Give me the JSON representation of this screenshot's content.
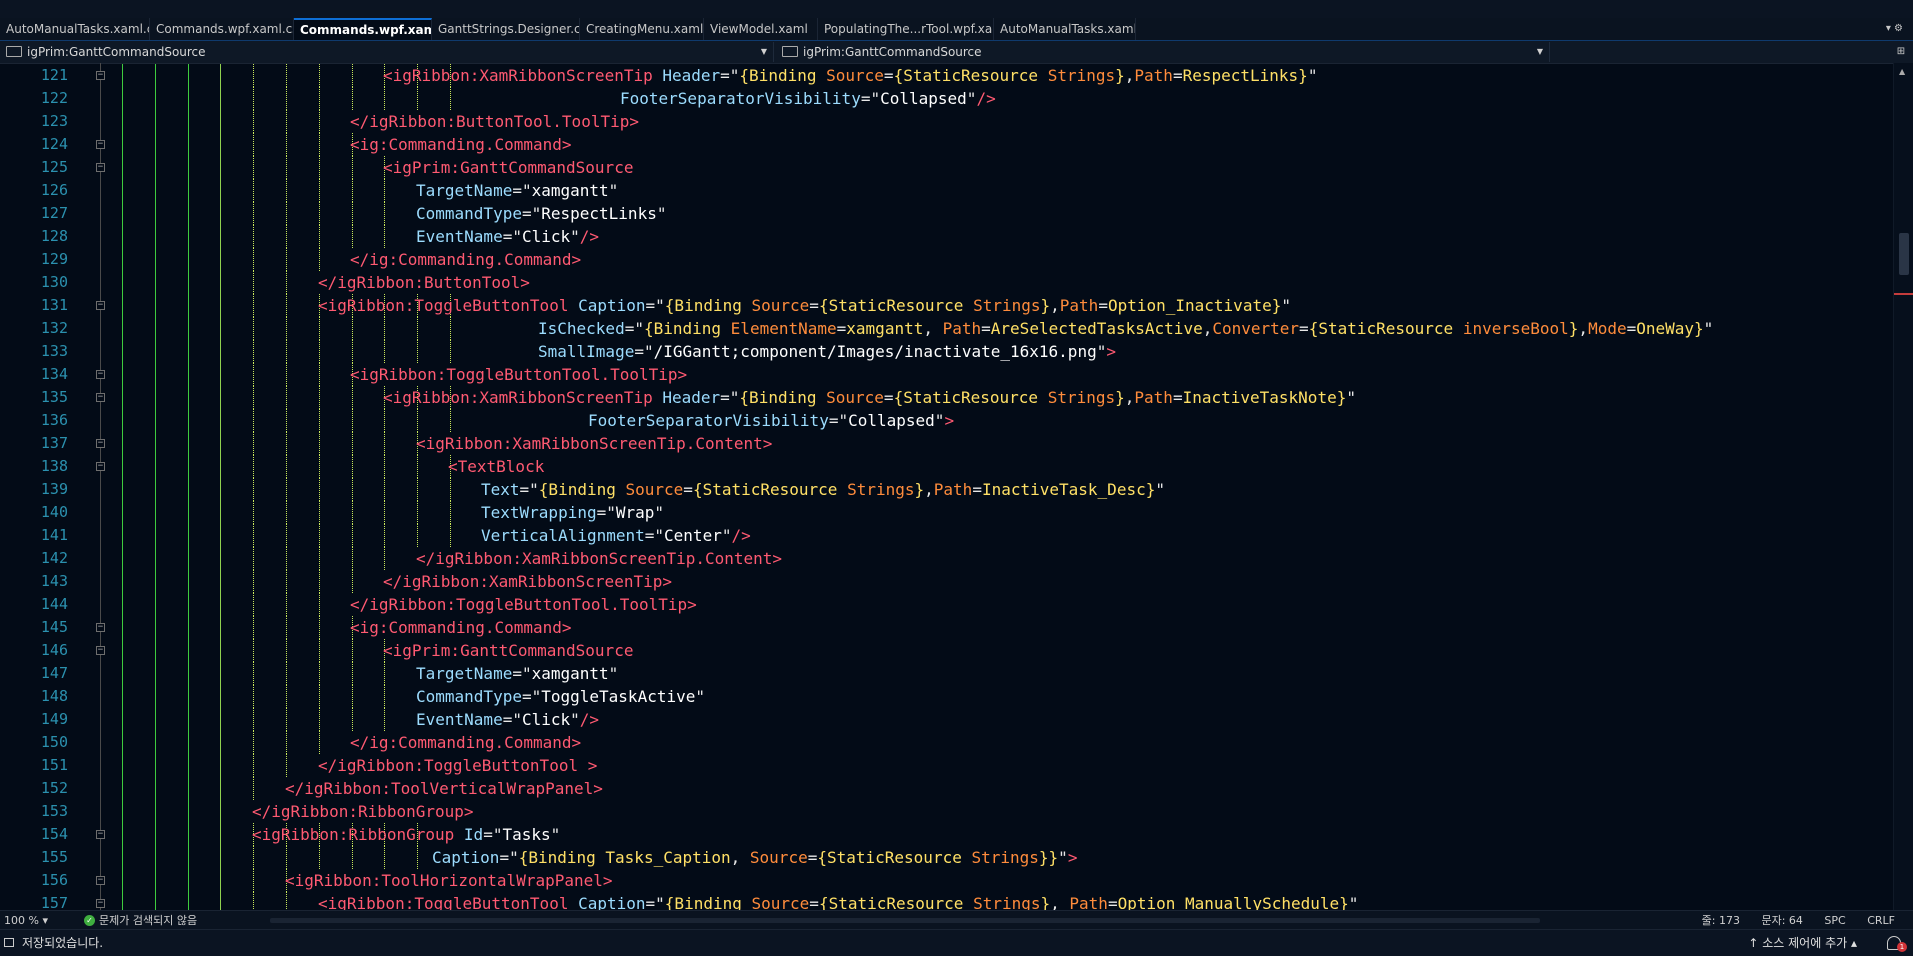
{
  "tabs": [
    {
      "label": "AutoManualTasks.xaml.cs",
      "pinned": true
    },
    {
      "label": "Commands.wpf.xaml.cs",
      "pinned": true
    },
    {
      "label": "Commands.wpf.xaml",
      "pinned": true,
      "active": true
    },
    {
      "label": "GanttStrings.Designer.cs"
    },
    {
      "label": "CreatingMenu.xaml"
    },
    {
      "label": "ViewModel.xaml"
    },
    {
      "label": "PopulatingThe...rTool.wpf.xaml"
    },
    {
      "label": "AutoManualTasks.xaml"
    }
  ],
  "tab_icons": {
    "pin": "📌",
    "close": "✕",
    "menu": "▾ ⚙"
  },
  "nav": {
    "left_selector": "igPrim:GanttCommandSource",
    "right_selector": "igPrim:GanttCommandSource"
  },
  "editor": {
    "line_numbers": [
      "121",
      "122",
      "123",
      "124",
      "125",
      "126",
      "127",
      "128",
      "129",
      "130",
      "131",
      "132",
      "133",
      "134",
      "135",
      "136",
      "137",
      "138",
      "139",
      "140",
      "141",
      "142",
      "143",
      "144",
      "145",
      "146",
      "147",
      "148",
      "149",
      "150",
      "151",
      "152",
      "153",
      "154",
      "155",
      "156",
      "157"
    ],
    "lines": [
      [
        [
          "b",
          "<"
        ],
        [
          "b",
          "igRibbon:XamRibbonScreenTip "
        ],
        [
          "a",
          "Header"
        ],
        [
          "p",
          "=\""
        ],
        [
          "y",
          "{Binding "
        ],
        [
          "k",
          "Source"
        ],
        [
          "p",
          "="
        ],
        [
          "y",
          "{StaticResource "
        ],
        [
          "k",
          "Strings"
        ],
        [
          "y",
          "}"
        ],
        [
          "p",
          ","
        ],
        [
          "k",
          "Path"
        ],
        [
          "p",
          "="
        ],
        [
          "y",
          "RespectLinks"
        ],
        [
          "y",
          "}"
        ],
        [
          "p",
          "\""
        ]
      ],
      [
        [
          "a",
          "FooterSeparatorVisibility"
        ],
        [
          "p",
          "=\""
        ],
        [
          "v",
          "Collapsed"
        ],
        [
          "p",
          "\""
        ],
        [
          "b",
          "/>"
        ]
      ],
      [
        [
          "b",
          "</igRibbon:ButtonTool.ToolTip>"
        ]
      ],
      [
        [
          "b",
          "<ig:Commanding.Command>"
        ]
      ],
      [
        [
          "b",
          "<igPrim:GanttCommandSource"
        ]
      ],
      [
        [
          "a",
          "TargetName"
        ],
        [
          "p",
          "=\""
        ],
        [
          "v",
          "xamgantt"
        ],
        [
          "p",
          "\""
        ]
      ],
      [
        [
          "a",
          "CommandType"
        ],
        [
          "p",
          "=\""
        ],
        [
          "v",
          "RespectLinks"
        ],
        [
          "p",
          "\""
        ]
      ],
      [
        [
          "a",
          "EventName"
        ],
        [
          "p",
          "=\""
        ],
        [
          "v",
          "Click"
        ],
        [
          "p",
          "\""
        ],
        [
          "b",
          "/>"
        ]
      ],
      [
        [
          "b",
          "</ig:Commanding.Command>"
        ]
      ],
      [
        [
          "b",
          "</igRibbon:ButtonTool>"
        ]
      ],
      [
        [
          "b",
          "<igRibbon:ToggleButtonTool "
        ],
        [
          "a",
          "Caption"
        ],
        [
          "p",
          "=\""
        ],
        [
          "y",
          "{Binding "
        ],
        [
          "k",
          "Source"
        ],
        [
          "p",
          "="
        ],
        [
          "y",
          "{StaticResource "
        ],
        [
          "k",
          "Strings"
        ],
        [
          "y",
          "}"
        ],
        [
          "p",
          ","
        ],
        [
          "k",
          "Path"
        ],
        [
          "p",
          "="
        ],
        [
          "y",
          "Option_Inactivate"
        ],
        [
          "y",
          "}"
        ],
        [
          "p",
          "\""
        ]
      ],
      [
        [
          "a",
          "IsChecked"
        ],
        [
          "p",
          "=\""
        ],
        [
          "y",
          "{Binding "
        ],
        [
          "k",
          "ElementName"
        ],
        [
          "p",
          "="
        ],
        [
          "y",
          "xamgantt"
        ],
        [
          "p",
          ", "
        ],
        [
          "k",
          "Path"
        ],
        [
          "p",
          "="
        ],
        [
          "y",
          "AreSelectedTasksActive"
        ],
        [
          "p",
          ","
        ],
        [
          "k",
          "Converter"
        ],
        [
          "p",
          "="
        ],
        [
          "y",
          "{StaticResource "
        ],
        [
          "k",
          "inverseBool"
        ],
        [
          "y",
          "}"
        ],
        [
          "p",
          ","
        ],
        [
          "k",
          "Mode"
        ],
        [
          "p",
          "="
        ],
        [
          "y",
          "OneWay"
        ],
        [
          "y",
          "}"
        ],
        [
          "p",
          "\""
        ]
      ],
      [
        [
          "a",
          "SmallImage"
        ],
        [
          "p",
          "=\""
        ],
        [
          "v",
          "/IGGantt;component/Images/inactivate_16x16.png"
        ],
        [
          "p",
          "\""
        ],
        [
          "b",
          ">"
        ]
      ],
      [
        [
          "b",
          "<igRibbon:ToggleButtonTool.ToolTip>"
        ]
      ],
      [
        [
          "b",
          "<igRibbon:XamRibbonScreenTip "
        ],
        [
          "a",
          "Header"
        ],
        [
          "p",
          "=\""
        ],
        [
          "y",
          "{Binding "
        ],
        [
          "k",
          "Source"
        ],
        [
          "p",
          "="
        ],
        [
          "y",
          "{StaticResource "
        ],
        [
          "k",
          "Strings"
        ],
        [
          "y",
          "}"
        ],
        [
          "p",
          ","
        ],
        [
          "k",
          "Path"
        ],
        [
          "p",
          "="
        ],
        [
          "y",
          "InactiveTaskNote"
        ],
        [
          "y",
          "}"
        ],
        [
          "p",
          "\""
        ]
      ],
      [
        [
          "a",
          "FooterSeparatorVisibility"
        ],
        [
          "p",
          "=\""
        ],
        [
          "v",
          "Collapsed"
        ],
        [
          "p",
          "\""
        ],
        [
          "b",
          ">"
        ]
      ],
      [
        [
          "b",
          "<igRibbon:XamRibbonScreenTip.Content>"
        ]
      ],
      [
        [
          "b",
          "<TextBlock"
        ]
      ],
      [
        [
          "a",
          "Text"
        ],
        [
          "p",
          "=\""
        ],
        [
          "y",
          "{Binding "
        ],
        [
          "k",
          "Source"
        ],
        [
          "p",
          "="
        ],
        [
          "y",
          "{StaticResource "
        ],
        [
          "k",
          "Strings"
        ],
        [
          "y",
          "}"
        ],
        [
          "p",
          ","
        ],
        [
          "k",
          "Path"
        ],
        [
          "p",
          "="
        ],
        [
          "y",
          "InactiveTask_Desc"
        ],
        [
          "y",
          "}"
        ],
        [
          "p",
          "\""
        ]
      ],
      [
        [
          "a",
          "TextWrapping"
        ],
        [
          "p",
          "=\""
        ],
        [
          "v",
          "Wrap"
        ],
        [
          "p",
          "\""
        ]
      ],
      [
        [
          "a",
          "VerticalAlignment"
        ],
        [
          "p",
          "=\""
        ],
        [
          "v",
          "Center"
        ],
        [
          "p",
          "\""
        ],
        [
          "b",
          "/>"
        ]
      ],
      [
        [
          "b",
          "</igRibbon:XamRibbonScreenTip.Content>"
        ]
      ],
      [
        [
          "b",
          "</igRibbon:XamRibbonScreenTip>"
        ]
      ],
      [
        [
          "b",
          "</igRibbon:ToggleButtonTool.ToolTip>"
        ]
      ],
      [
        [
          "b",
          "<ig:Commanding.Command>"
        ]
      ],
      [
        [
          "b",
          "<igPrim:GanttCommandSource"
        ]
      ],
      [
        [
          "a",
          "TargetName"
        ],
        [
          "p",
          "=\""
        ],
        [
          "v",
          "xamgantt"
        ],
        [
          "p",
          "\""
        ]
      ],
      [
        [
          "a",
          "CommandType"
        ],
        [
          "p",
          "=\""
        ],
        [
          "v",
          "ToggleTaskActive"
        ],
        [
          "p",
          "\""
        ]
      ],
      [
        [
          "a",
          "EventName"
        ],
        [
          "p",
          "=\""
        ],
        [
          "v",
          "Click"
        ],
        [
          "p",
          "\""
        ],
        [
          "b",
          "/>"
        ]
      ],
      [
        [
          "b",
          "</ig:Commanding.Command>"
        ]
      ],
      [
        [
          "b",
          "</igRibbon:ToggleButtonTool "
        ],
        [
          "b",
          ">"
        ]
      ],
      [
        [
          "b",
          "</igRibbon:ToolVerticalWrapPanel>"
        ]
      ],
      [
        [
          "b",
          "</igRibbon:RibbonGroup>"
        ]
      ],
      [
        [
          "b",
          "<igRibbon:RibbonGroup "
        ],
        [
          "a",
          "Id"
        ],
        [
          "p",
          "=\""
        ],
        [
          "v",
          "Tasks"
        ],
        [
          "p",
          "\""
        ]
      ],
      [
        [
          "a",
          "Caption"
        ],
        [
          "p",
          "=\""
        ],
        [
          "y",
          "{Binding "
        ],
        [
          "y",
          "Tasks_Caption"
        ],
        [
          "p",
          ", "
        ],
        [
          "k",
          "Source"
        ],
        [
          "p",
          "="
        ],
        [
          "y",
          "{StaticResource "
        ],
        [
          "k",
          "Strings"
        ],
        [
          "y",
          "}}"
        ],
        [
          "p",
          "\""
        ],
        [
          "b",
          ">"
        ]
      ],
      [
        [
          "b",
          "<igRibbon:ToolHorizontalWrapPanel>"
        ]
      ],
      [
        [
          "b",
          "<igRibbon:ToggleButtonTool "
        ],
        [
          "a",
          "Caption"
        ],
        [
          "p",
          "=\""
        ],
        [
          "y",
          "{Binding "
        ],
        [
          "k",
          "Source"
        ],
        [
          "p",
          "="
        ],
        [
          "y",
          "{StaticResource "
        ],
        [
          "k",
          "Strings"
        ],
        [
          "y",
          "}"
        ],
        [
          "p",
          ", "
        ],
        [
          "k",
          "Path"
        ],
        [
          "p",
          "="
        ],
        [
          "y",
          "Option ManuallySchedule"
        ],
        [
          "y",
          "}"
        ],
        [
          "p",
          "\""
        ]
      ]
    ]
  },
  "zoom_bar": {
    "zoom": "100 %",
    "zoom_chevron": "▾",
    "issues": "문제가 검색되지 않음",
    "line": "줄: 173",
    "char": "문자: 64",
    "spc": "SPC",
    "crlf": "CRLF"
  },
  "status": {
    "message": "저장되었습니다.",
    "source_control": "↑  소스 제어에 추가  ▴",
    "notification_count": "1"
  }
}
